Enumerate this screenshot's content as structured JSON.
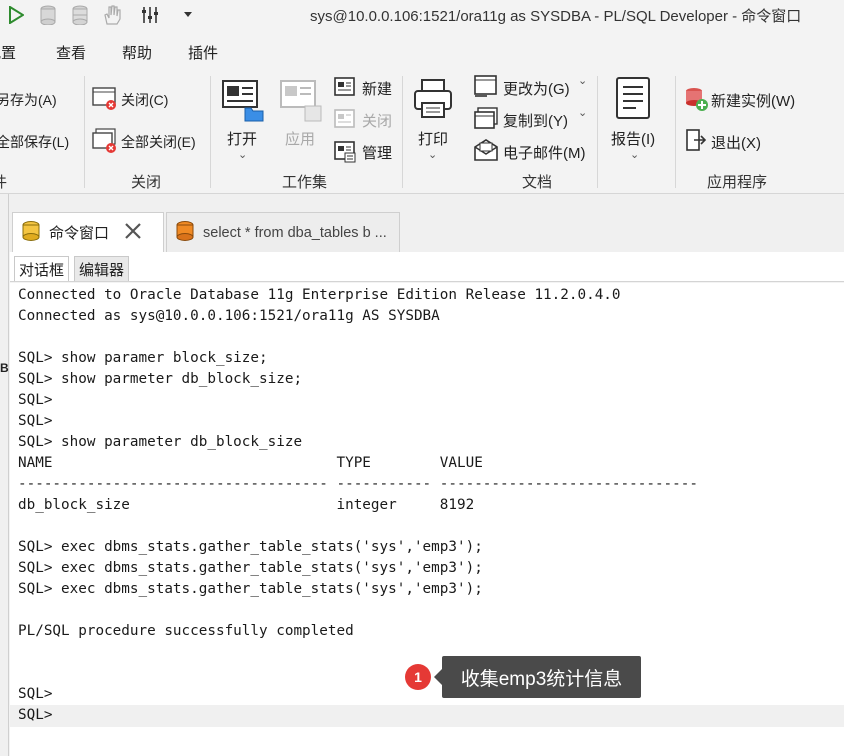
{
  "window": {
    "title": "sys@10.0.0.106:1521/ora11g as SYSDBA - PL/SQL Developer - 命令窗口"
  },
  "menu": [
    "配置",
    "查看",
    "帮助",
    "插件"
  ],
  "ribbon": {
    "file_group": {
      "save_as": "另存为(A)",
      "save_all": "全部保存(L)",
      "label_partial": "件"
    },
    "close_group": {
      "close": "关闭(C)",
      "close_all": "全部关闭(E)",
      "label": "关闭"
    },
    "workset_group": {
      "open": "打开",
      "apply": "应用",
      "new": "新建",
      "close": "关闭",
      "manage": "管理",
      "label": "工作集"
    },
    "document_group": {
      "print": "打印",
      "change_to": "更改为(G)",
      "copy_to": "复制到(Y)",
      "email": "电子邮件(M)",
      "label": "文档"
    },
    "report_group": {
      "report": "报告(I)"
    },
    "app_group": {
      "new_instance": "新建实例(W)",
      "exit": "退出(X)",
      "label": "应用程序"
    }
  },
  "left_edge_char": "B",
  "doc_tabs": [
    {
      "label": "命令窗口",
      "active": true
    },
    {
      "label": "select * from dba_tables b ...",
      "active": false
    }
  ],
  "sub_tabs": [
    {
      "label": "对话框",
      "active": true
    },
    {
      "label": "编辑器",
      "active": false
    }
  ],
  "console_lines": [
    "Connected to Oracle Database 11g Enterprise Edition Release 11.2.0.4.0",
    "Connected as sys@10.0.0.106:1521/ora11g AS SYSDBA",
    "",
    "SQL> show paramer block_size;",
    "SQL> show parmeter db_block_size;",
    "SQL>",
    "SQL>",
    "SQL> show parameter db_block_size",
    "NAME                                 TYPE        VALUE",
    "------------------------------------ ----------- ------------------------------",
    "db_block_size                        integer     8192",
    "",
    "SQL> exec dbms_stats.gather_table_stats('sys','emp3');",
    "SQL> exec dbms_stats.gather_table_stats('sys','emp3');",
    "SQL> exec dbms_stats.gather_table_stats('sys','emp3');",
    "",
    "PL/SQL procedure successfully completed",
    "",
    "",
    "SQL>",
    "SQL>"
  ],
  "callout": {
    "number": "1",
    "text": "收集emp3统计信息"
  }
}
